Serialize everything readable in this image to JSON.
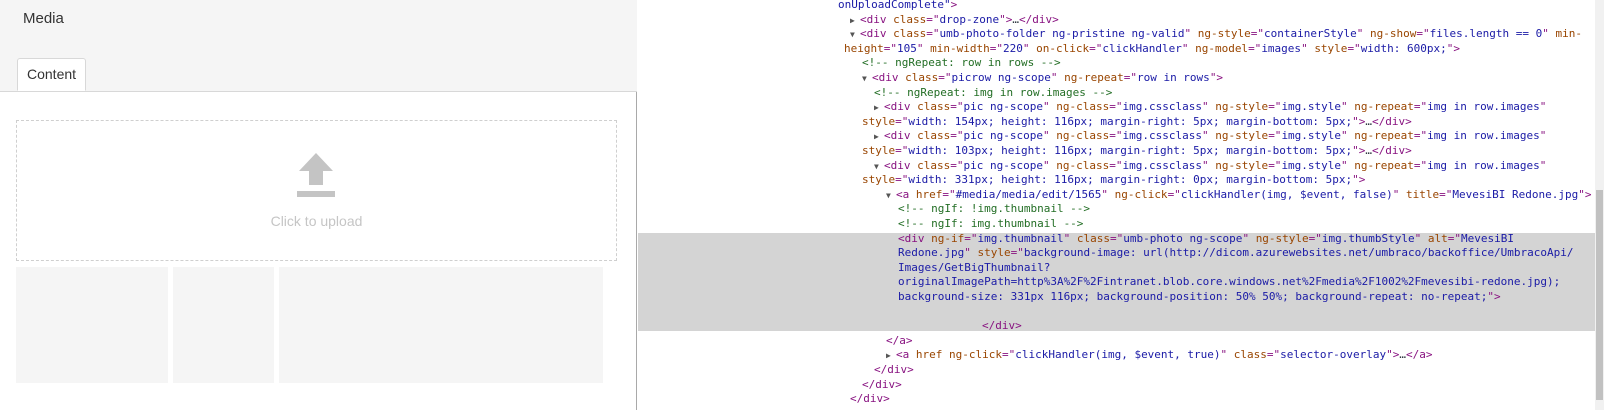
{
  "left_pane": {
    "title": "Media",
    "tab_label": "Content",
    "upload_label": "Click to upload",
    "thumbnails": [
      {
        "name": "thumb-1"
      },
      {
        "name": "thumb-2"
      },
      {
        "name": "thumb-3"
      }
    ]
  },
  "devtools": {
    "lines": [
      {
        "indent": 0,
        "tri": "",
        "parts": [
          {
            "t": "val",
            "s": "onUploadComplete\""
          },
          {
            "t": "tag",
            "s": ">"
          }
        ]
      },
      {
        "indent": 1,
        "tri": "▶",
        "parts": [
          {
            "t": "tag",
            "s": "<div "
          },
          {
            "t": "attr",
            "s": "class"
          },
          {
            "t": "tag",
            "s": "=\""
          },
          {
            "t": "val",
            "s": "drop-zone"
          },
          {
            "t": "tag",
            "s": "\">"
          },
          {
            "t": "plain",
            "s": "…"
          },
          {
            "t": "tag",
            "s": "</div>"
          }
        ]
      },
      {
        "indent": 1,
        "tri": "▼",
        "parts": [
          {
            "t": "tag",
            "s": "<div "
          },
          {
            "t": "attr",
            "s": "class"
          },
          {
            "t": "tag",
            "s": "=\""
          },
          {
            "t": "val",
            "s": "umb-photo-folder ng-pristine ng-valid"
          },
          {
            "t": "tag",
            "s": "\" "
          },
          {
            "t": "attr",
            "s": "ng-style"
          },
          {
            "t": "tag",
            "s": "=\""
          },
          {
            "t": "val",
            "s": "containerStyle"
          },
          {
            "t": "tag",
            "s": "\" "
          },
          {
            "t": "attr",
            "s": "ng-show"
          },
          {
            "t": "tag",
            "s": "=\""
          },
          {
            "t": "val",
            "s": "files.length == 0"
          },
          {
            "t": "tag",
            "s": "\" "
          },
          {
            "t": "attr",
            "s": "min-"
          }
        ]
      },
      {
        "indent": 0.5,
        "tri": "",
        "parts": [
          {
            "t": "attr",
            "s": "height"
          },
          {
            "t": "tag",
            "s": "=\""
          },
          {
            "t": "val",
            "s": "105"
          },
          {
            "t": "tag",
            "s": "\" "
          },
          {
            "t": "attr",
            "s": "min-width"
          },
          {
            "t": "tag",
            "s": "=\""
          },
          {
            "t": "val",
            "s": "220"
          },
          {
            "t": "tag",
            "s": "\" "
          },
          {
            "t": "attr",
            "s": "on-click"
          },
          {
            "t": "tag",
            "s": "=\""
          },
          {
            "t": "val",
            "s": "clickHandler"
          },
          {
            "t": "tag",
            "s": "\" "
          },
          {
            "t": "attr",
            "s": "ng-model"
          },
          {
            "t": "tag",
            "s": "=\""
          },
          {
            "t": "val",
            "s": "images"
          },
          {
            "t": "tag",
            "s": "\" "
          },
          {
            "t": "attr",
            "s": "style"
          },
          {
            "t": "tag",
            "s": "=\""
          },
          {
            "t": "val",
            "s": "width: 600px;"
          },
          {
            "t": "tag",
            "s": "\">"
          }
        ]
      },
      {
        "indent": 2,
        "tri": "",
        "parts": [
          {
            "t": "cmt",
            "s": "<!-- ngRepeat: row in rows -->"
          }
        ]
      },
      {
        "indent": 2,
        "tri": "▼",
        "parts": [
          {
            "t": "tag",
            "s": "<div "
          },
          {
            "t": "attr",
            "s": "class"
          },
          {
            "t": "tag",
            "s": "=\""
          },
          {
            "t": "val",
            "s": "picrow ng-scope"
          },
          {
            "t": "tag",
            "s": "\" "
          },
          {
            "t": "attr",
            "s": "ng-repeat"
          },
          {
            "t": "tag",
            "s": "=\""
          },
          {
            "t": "val",
            "s": "row in rows"
          },
          {
            "t": "tag",
            "s": "\">"
          }
        ]
      },
      {
        "indent": 3,
        "tri": "",
        "parts": [
          {
            "t": "cmt",
            "s": "<!-- ngRepeat: img in row.images -->"
          }
        ]
      },
      {
        "indent": 3,
        "tri": "▶",
        "parts": [
          {
            "t": "tag",
            "s": "<div "
          },
          {
            "t": "attr",
            "s": "class"
          },
          {
            "t": "tag",
            "s": "=\""
          },
          {
            "t": "val",
            "s": "pic ng-scope"
          },
          {
            "t": "tag",
            "s": "\" "
          },
          {
            "t": "attr",
            "s": "ng-class"
          },
          {
            "t": "tag",
            "s": "=\""
          },
          {
            "t": "val",
            "s": "img.cssclass"
          },
          {
            "t": "tag",
            "s": "\" "
          },
          {
            "t": "attr",
            "s": "ng-style"
          },
          {
            "t": "tag",
            "s": "=\""
          },
          {
            "t": "val",
            "s": "img.style"
          },
          {
            "t": "tag",
            "s": "\" "
          },
          {
            "t": "attr",
            "s": "ng-repeat"
          },
          {
            "t": "tag",
            "s": "=\""
          },
          {
            "t": "val",
            "s": "img in row.images"
          },
          {
            "t": "tag",
            "s": "\""
          }
        ]
      },
      {
        "indent": 2,
        "tri": "",
        "parts": [
          {
            "t": "attr",
            "s": "style"
          },
          {
            "t": "tag",
            "s": "=\""
          },
          {
            "t": "val",
            "s": "width: 154px; height: 116px; margin-right: 5px; margin-bottom: 5px;"
          },
          {
            "t": "tag",
            "s": "\">"
          },
          {
            "t": "plain",
            "s": "…"
          },
          {
            "t": "tag",
            "s": "</div>"
          }
        ]
      },
      {
        "indent": 3,
        "tri": "▶",
        "parts": [
          {
            "t": "tag",
            "s": "<div "
          },
          {
            "t": "attr",
            "s": "class"
          },
          {
            "t": "tag",
            "s": "=\""
          },
          {
            "t": "val",
            "s": "pic ng-scope"
          },
          {
            "t": "tag",
            "s": "\" "
          },
          {
            "t": "attr",
            "s": "ng-class"
          },
          {
            "t": "tag",
            "s": "=\""
          },
          {
            "t": "val",
            "s": "img.cssclass"
          },
          {
            "t": "tag",
            "s": "\" "
          },
          {
            "t": "attr",
            "s": "ng-style"
          },
          {
            "t": "tag",
            "s": "=\""
          },
          {
            "t": "val",
            "s": "img.style"
          },
          {
            "t": "tag",
            "s": "\" "
          },
          {
            "t": "attr",
            "s": "ng-repeat"
          },
          {
            "t": "tag",
            "s": "=\""
          },
          {
            "t": "val",
            "s": "img in row.images"
          },
          {
            "t": "tag",
            "s": "\""
          }
        ]
      },
      {
        "indent": 2,
        "tri": "",
        "parts": [
          {
            "t": "attr",
            "s": "style"
          },
          {
            "t": "tag",
            "s": "=\""
          },
          {
            "t": "val",
            "s": "width: 103px; height: 116px; margin-right: 5px; margin-bottom: 5px;"
          },
          {
            "t": "tag",
            "s": "\">"
          },
          {
            "t": "plain",
            "s": "…"
          },
          {
            "t": "tag",
            "s": "</div>"
          }
        ]
      },
      {
        "indent": 3,
        "tri": "▼",
        "parts": [
          {
            "t": "tag",
            "s": "<div "
          },
          {
            "t": "attr",
            "s": "class"
          },
          {
            "t": "tag",
            "s": "=\""
          },
          {
            "t": "val",
            "s": "pic ng-scope"
          },
          {
            "t": "tag",
            "s": "\" "
          },
          {
            "t": "attr",
            "s": "ng-class"
          },
          {
            "t": "tag",
            "s": "=\""
          },
          {
            "t": "val",
            "s": "img.cssclass"
          },
          {
            "t": "tag",
            "s": "\" "
          },
          {
            "t": "attr",
            "s": "ng-style"
          },
          {
            "t": "tag",
            "s": "=\""
          },
          {
            "t": "val",
            "s": "img.style"
          },
          {
            "t": "tag",
            "s": "\" "
          },
          {
            "t": "attr",
            "s": "ng-repeat"
          },
          {
            "t": "tag",
            "s": "=\""
          },
          {
            "t": "val",
            "s": "img in row.images"
          },
          {
            "t": "tag",
            "s": "\""
          }
        ]
      },
      {
        "indent": 2,
        "tri": "",
        "parts": [
          {
            "t": "attr",
            "s": "style"
          },
          {
            "t": "tag",
            "s": "=\""
          },
          {
            "t": "val",
            "s": "width: 331px; height: 116px; margin-right: 0px; margin-bottom: 5px;"
          },
          {
            "t": "tag",
            "s": "\">"
          }
        ]
      },
      {
        "indent": 4,
        "tri": "▼",
        "parts": [
          {
            "t": "tag",
            "s": "<a "
          },
          {
            "t": "attr",
            "s": "href"
          },
          {
            "t": "tag",
            "s": "=\""
          },
          {
            "t": "val",
            "s": "#media/media/edit/1565"
          },
          {
            "t": "tag",
            "s": "\" "
          },
          {
            "t": "attr",
            "s": "ng-click"
          },
          {
            "t": "tag",
            "s": "=\""
          },
          {
            "t": "val",
            "s": "clickHandler(img, $event, false)"
          },
          {
            "t": "tag",
            "s": "\" "
          },
          {
            "t": "attr",
            "s": "title"
          },
          {
            "t": "tag",
            "s": "=\""
          },
          {
            "t": "val",
            "s": "MevesiBI Redone.jpg"
          },
          {
            "t": "tag",
            "s": "\">"
          }
        ]
      },
      {
        "indent": 5,
        "tri": "",
        "parts": [
          {
            "t": "cmt",
            "s": "<!-- ngIf: !img.thumbnail -->"
          }
        ]
      },
      {
        "indent": 5,
        "tri": "",
        "parts": [
          {
            "t": "cmt",
            "s": "<!-- ngIf: img.thumbnail -->"
          }
        ]
      },
      {
        "indent": 5,
        "tri": "",
        "parts": [
          {
            "t": "tag",
            "s": "<div "
          },
          {
            "t": "attr",
            "s": "ng-if"
          },
          {
            "t": "tag",
            "s": "=\""
          },
          {
            "t": "val",
            "s": "img.thumbnail"
          },
          {
            "t": "tag",
            "s": "\" "
          },
          {
            "t": "attr",
            "s": "class"
          },
          {
            "t": "tag",
            "s": "=\""
          },
          {
            "t": "val",
            "s": "umb-photo ng-scope"
          },
          {
            "t": "tag",
            "s": "\" "
          },
          {
            "t": "attr",
            "s": "ng-style"
          },
          {
            "t": "tag",
            "s": "=\""
          },
          {
            "t": "val",
            "s": "img.thumbStyle"
          },
          {
            "t": "tag",
            "s": "\" "
          },
          {
            "t": "attr",
            "s": "alt"
          },
          {
            "t": "tag",
            "s": "=\""
          },
          {
            "t": "val",
            "s": "MevesiBI"
          }
        ]
      },
      {
        "indent": 5,
        "tri": "",
        "parts": [
          {
            "t": "val",
            "s": "Redone.jpg"
          },
          {
            "t": "tag",
            "s": "\" "
          },
          {
            "t": "attr",
            "s": "style"
          },
          {
            "t": "tag",
            "s": "=\""
          },
          {
            "t": "val",
            "s": "background-image: url(http://dicom.azurewebsites.net/umbraco/backoffice/UmbracoApi/"
          }
        ]
      },
      {
        "indent": 5,
        "tri": "",
        "parts": [
          {
            "t": "val",
            "s": "Images/GetBigThumbnail?"
          }
        ]
      },
      {
        "indent": 5,
        "tri": "",
        "parts": [
          {
            "t": "val",
            "s": "originalImagePath=http%3A%2F%2Fintranet.blob.core.windows.net%2Fmedia%2F1002%2Fmevesibi-redone.jpg);"
          }
        ]
      },
      {
        "indent": 5,
        "tri": "",
        "parts": [
          {
            "t": "val",
            "s": "background-size: 331px 116px; background-position: 50% 50%; background-repeat: no-repeat;"
          },
          {
            "t": "tag",
            "s": "\">"
          }
        ]
      },
      {
        "indent": 0,
        "tri": "",
        "parts": [
          {
            "t": "plain",
            "s": " "
          }
        ]
      },
      {
        "indent": 12,
        "tri": "",
        "parts": [
          {
            "t": "tag",
            "s": "</div>"
          }
        ]
      },
      {
        "indent": 4,
        "tri": "",
        "parts": [
          {
            "t": "tag",
            "s": "</a>"
          }
        ]
      },
      {
        "indent": 4,
        "tri": "▶",
        "parts": [
          {
            "t": "tag",
            "s": "<a "
          },
          {
            "t": "attr",
            "s": "href"
          },
          {
            "t": "tag",
            "s": " "
          },
          {
            "t": "attr",
            "s": "ng-click"
          },
          {
            "t": "tag",
            "s": "=\""
          },
          {
            "t": "val",
            "s": "clickHandler(img, $event, true)"
          },
          {
            "t": "tag",
            "s": "\" "
          },
          {
            "t": "attr",
            "s": "class"
          },
          {
            "t": "tag",
            "s": "=\""
          },
          {
            "t": "val",
            "s": "selector-overlay"
          },
          {
            "t": "tag",
            "s": "\">"
          },
          {
            "t": "plain",
            "s": "…"
          },
          {
            "t": "tag",
            "s": "</a>"
          }
        ]
      },
      {
        "indent": 3,
        "tri": "",
        "parts": [
          {
            "t": "tag",
            "s": "</div>"
          }
        ]
      },
      {
        "indent": 2,
        "tri": "",
        "parts": [
          {
            "t": "tag",
            "s": "</div>"
          }
        ]
      },
      {
        "indent": 1,
        "tri": "",
        "parts": [
          {
            "t": "tag",
            "s": "</div>"
          }
        ]
      }
    ]
  }
}
